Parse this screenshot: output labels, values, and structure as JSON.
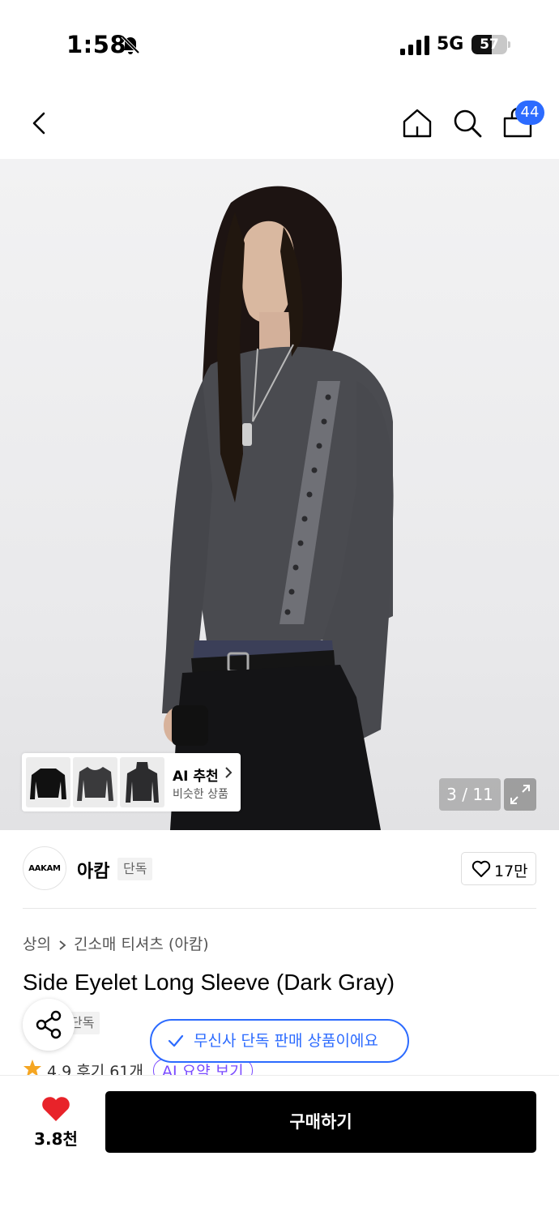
{
  "status_bar": {
    "time": "1:58",
    "network": "5G",
    "battery": "57",
    "battery_level": 0.57
  },
  "nav": {
    "cart_count": "44"
  },
  "gallery": {
    "counter": "3 / 11",
    "ai_title": "AI 추천",
    "ai_subtitle": "비슷한 상품"
  },
  "brand": {
    "logo_text": "AAKAM",
    "name": "아캄",
    "tag": "단독",
    "likes": "17만"
  },
  "product": {
    "breadcrumb": [
      "상의",
      "긴소매 티셔츠 (아캄)"
    ],
    "title": "Side Eyelet Long Sleeve (Dark Gray)",
    "badge": "단독",
    "exclusive_notice": "무신사 단독 판매 상품이에요",
    "rating": "4.9",
    "reviews": "후기 61개",
    "ai_summary": "AI 요약 보기"
  },
  "bottom_bar": {
    "wish_count": "3.8천",
    "buy_label": "구매하기"
  },
  "colors": {
    "accent": "#2c6bff",
    "heart": "#e8232a",
    "buy": "#000000",
    "ai": "#7a4bff",
    "star": "#f5a623"
  }
}
